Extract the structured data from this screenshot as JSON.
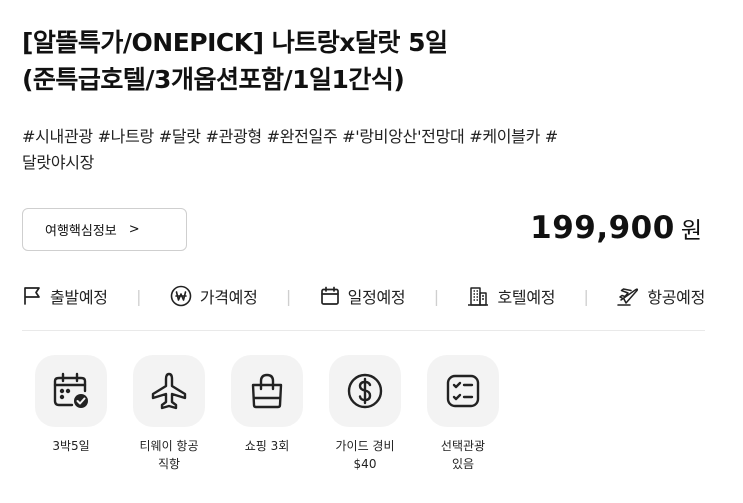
{
  "product": {
    "title_line1": "[알뜰특가/ONEPICK] 나트랑x달랏 5일",
    "title_line2": "(준특급호텔/3개옵션포함/1일1간식)",
    "tags_line1": "#시내관광 #나트랑 #달랏 #관광형 #완전일주 #'랑비앙산'전망대 #케이블카 #",
    "tags_line2": "달랏야시장"
  },
  "info_button": {
    "label": "여행핵심정보",
    "chevron": ">"
  },
  "price": {
    "amount": "199,900",
    "unit": "원"
  },
  "status_items": [
    {
      "label": "출발예정",
      "icon": "flag-icon"
    },
    {
      "label": "가격예정",
      "icon": "won-circle-icon"
    },
    {
      "label": "일정예정",
      "icon": "calendar-icon"
    },
    {
      "label": "호텔예정",
      "icon": "hotel-building-icon"
    },
    {
      "label": "항공예정",
      "icon": "airplane-icon"
    }
  ],
  "features": [
    {
      "line1": "3박5일",
      "line2": "",
      "icon": "calendar-check-icon"
    },
    {
      "line1": "티웨이 항공",
      "line2": "직항",
      "icon": "airplane-icon"
    },
    {
      "line1": "쇼핑 3회",
      "line2": "",
      "icon": "shopping-bag-icon"
    },
    {
      "line1": "가이드 경비",
      "line2": "$40",
      "icon": "dollar-circle-icon"
    },
    {
      "line1": "선택관광",
      "line2": "있음",
      "icon": "checklist-icon"
    }
  ],
  "colors": {
    "text": "#111111",
    "icon_bg": "#f3f3f3",
    "border": "#cfcfcf",
    "divider": "#e9e9e9"
  }
}
